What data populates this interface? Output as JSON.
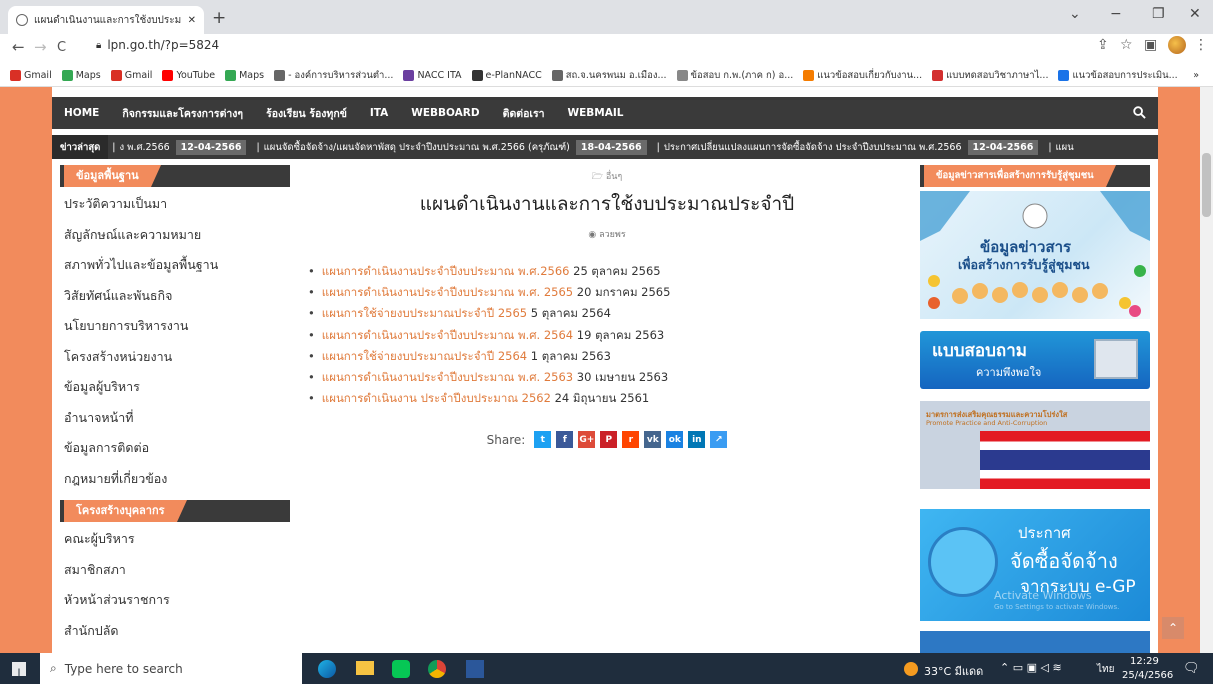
{
  "browser": {
    "tab_title": "แผนดำเนินงานและการใช้งบประมาณป่ะ",
    "url": "lpn.go.th/?p=5824",
    "bookmarks": [
      {
        "label": "Gmail",
        "color": "#d93025"
      },
      {
        "label": "Maps",
        "color": "#34a853"
      },
      {
        "label": "Gmail",
        "color": "#d93025"
      },
      {
        "label": "YouTube",
        "color": "#ff0000"
      },
      {
        "label": "Maps",
        "color": "#34a853"
      },
      {
        "label": "- องค์การบริหารส่วนตำ...",
        "color": "#666666"
      },
      {
        "label": "NACC ITA",
        "color": "#6b3fa0"
      },
      {
        "label": "e-PlanNACC",
        "color": "#333333"
      },
      {
        "label": "สถ.จ.นครพนม อ.เมือง...",
        "color": "#666666"
      },
      {
        "label": "ข้อสอบ ก.พ.(ภาค ก) อ...",
        "color": "#888888"
      },
      {
        "label": "แนวข้อสอบเกี่ยวกับงาน...",
        "color": "#f57c00"
      },
      {
        "label": "แบบทดสอบวิชาภาษาไ...",
        "color": "#d32f2f"
      },
      {
        "label": "แนวข้อสอบการประเมิน...",
        "color": "#1a73e8"
      }
    ],
    "more": "»"
  },
  "site": {
    "nav": [
      "HOME",
      "กิจกรรมและโครงการต่างๆ",
      "ร้องเรียน ร้องทุกข์",
      "ITA",
      "WEBBOARD",
      "ติดต่อเรา",
      "WEBMAIL"
    ],
    "ticker": {
      "label": "ข่าวล่าสุด",
      "items": [
        {
          "date": "",
          "text": "ง พ.ศ.2566"
        },
        {
          "date": "12-04-2566",
          "text": "แผนจัดซื้อจัดจ้าง/แผนจัดหาพัสดุ ประจำปีงบประมาณ พ.ศ.2566 (ครุภัณฑ์)"
        },
        {
          "date": "18-04-2566",
          "text": "ประกาศเปลี่ยนแปลงแผนการจัดซื้อจัดจ้าง ประจำปีงบประมาณ พ.ศ.2566"
        },
        {
          "date": "12-04-2566",
          "text": "แผน"
        }
      ]
    },
    "left": {
      "section1": "ข้อมูลพื้นฐาน",
      "items1": [
        "ประวัติความเป็นมา",
        "สัญลักษณ์และความหมาย",
        "สภาพทั่วไปและข้อมูลพื้นฐาน",
        "วิสัยทัศน์และพันธกิจ",
        "นโยบายการบริหารงาน",
        "โครงสร้างหน่วยงาน",
        "ข้อมูลผู้บริหาร",
        "อำนาจหน้าที่",
        "ข้อมูลการติดต่อ",
        "กฎหมายที่เกี่ยวข้อง"
      ],
      "section2": "โครงสร้างบุคลากร",
      "items2": [
        "คณะผู้บริหาร",
        "สมาชิกสภา",
        "หัวหน้าส่วนราชการ",
        "สำนักปลัด"
      ]
    },
    "main": {
      "category": "อื่นๆ",
      "title": "แผนดำเนินงานและการใช้งบประมาณประจำปี",
      "author": "ลวยพร",
      "posts": [
        {
          "link": "แผนการดำเนินงานประจำปีงบประมาณ พ.ศ.2566",
          "date": "25 ตุลาคม 2565"
        },
        {
          "link": "แผนการดำเนินงานประจำปีงบประมาณ พ.ศ. 2565",
          "date": "20 มกราคม 2565"
        },
        {
          "link": "แผนการใช้จ่ายงบประมาณประจำปี 2565",
          "date": "5 ตุลาคม 2564"
        },
        {
          "link": "แผนการดำเนินงานประจำปีงบประมาณ พ.ศ. 2564",
          "date": "19 ตุลาคม 2563"
        },
        {
          "link": "แผนการใช้จ่ายงบประมาณประจำปี 2564",
          "date": "1 ตุลาคม 2563"
        },
        {
          "link": "แผนการดำเนินงานประจำปีงบประมาณ พ.ศ. 2563",
          "date": "30 เมษายน 2563"
        },
        {
          "link": "แผนการดำเนินงาน ประจำปีงบประมาณ 2562",
          "date": "24 มิถุนายน 2561"
        }
      ],
      "share_label": "Share:",
      "share_buttons": [
        {
          "glyph": "t",
          "color": "#1da1f2"
        },
        {
          "glyph": "f",
          "color": "#3b5998"
        },
        {
          "glyph": "G+",
          "color": "#dd4b39"
        },
        {
          "glyph": "P",
          "color": "#cb2027"
        },
        {
          "glyph": "r",
          "color": "#ff4500"
        },
        {
          "glyph": "vk",
          "color": "#45668e"
        },
        {
          "glyph": "ok",
          "color": "#1a82e2"
        },
        {
          "glyph": "in",
          "color": "#0077b5"
        },
        {
          "glyph": "↗",
          "color": "#3a9cf2"
        }
      ]
    },
    "right": {
      "section": "ข้อมูลข่าวสารเพื่อสร้างการรับรู้สู่ชุมชน",
      "banner1_line1": "ข้อมูลข่าวสาร",
      "banner1_line2": "เพื่อสร้างการรับรู้สู่ชุมชน",
      "banner2_line1": "แบบสอบถาม",
      "banner2_line2": "ความพึงพอใจ",
      "banner3_line1": "มาตรการส่งเสริมคุณธรรมและความโปร่งใส",
      "banner3_line2": "Promote Practice and Anti-Corruption",
      "banner4_line1": "ประกาศ",
      "banner4_line2": "จัดซื้อจัดจ้าง",
      "banner4_line3": "จากระบบ e-GP",
      "watermark1": "Activate Windows",
      "watermark2": "Go to Settings to activate Windows."
    }
  },
  "taskbar": {
    "search_placeholder": "Type here to search",
    "weather": "33°C มีแดด",
    "lang": "ไทย",
    "time": "12:29",
    "date": "25/4/2566"
  }
}
